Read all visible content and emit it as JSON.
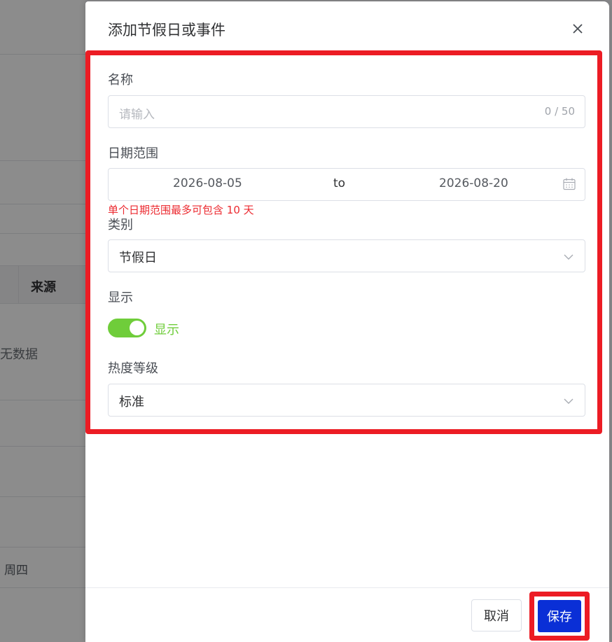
{
  "background": {
    "source_header": "来源",
    "empty_text": "暂无数据",
    "weekday": "周四"
  },
  "drawer": {
    "title": "添加节假日或事件",
    "close_icon": "close-icon"
  },
  "form": {
    "name": {
      "label": "名称",
      "placeholder": "请输入",
      "counter": "0 / 50"
    },
    "date_range": {
      "label": "日期范围",
      "start": "2026-08-05",
      "separator": "to",
      "end": "2026-08-20",
      "icon": "calendar-icon",
      "error": "单个日期范围最多可包含 10 天"
    },
    "category": {
      "label": "类别",
      "value": "节假日",
      "icon": "chevron-down-icon"
    },
    "display": {
      "label": "显示",
      "switch_on": true,
      "switch_text": "显示"
    },
    "heat_level": {
      "label": "热度等级",
      "value": "标准",
      "icon": "chevron-down-icon"
    }
  },
  "footer": {
    "cancel_label": "取消",
    "save_label": "保存"
  },
  "colors": {
    "highlight": "#ec1c24",
    "switch_on": "#6fcd3a",
    "primary": "#0a2fd6",
    "error": "#ec2a30"
  }
}
